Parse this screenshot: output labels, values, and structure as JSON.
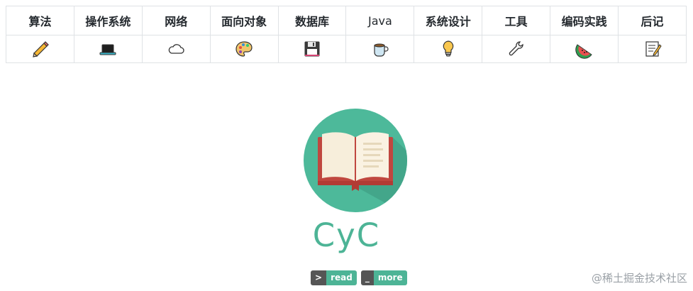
{
  "nav": {
    "headers": [
      {
        "label": "算法",
        "icon": "pencil-icon"
      },
      {
        "label": "操作系统",
        "icon": "laptop-icon"
      },
      {
        "label": "网络",
        "icon": "cloud-icon"
      },
      {
        "label": "面向对象",
        "icon": "art-palette-icon"
      },
      {
        "label": "数据库",
        "icon": "floppy-disk-icon"
      },
      {
        "label": "Java",
        "icon": "coffee-cup-icon"
      },
      {
        "label": "系统设计",
        "icon": "light-bulb-icon"
      },
      {
        "label": "工具",
        "icon": "wrench-icon"
      },
      {
        "label": "编码实践",
        "icon": "watermelon-icon"
      },
      {
        "label": "后记",
        "icon": "memo-icon"
      }
    ]
  },
  "brand": {
    "title": "CyC",
    "accent_color": "#4db496"
  },
  "badges": [
    {
      "prefix": ">",
      "label": "read"
    },
    {
      "prefix": "_",
      "label": "more"
    }
  ],
  "watermark": "@稀土掘金技术社区"
}
